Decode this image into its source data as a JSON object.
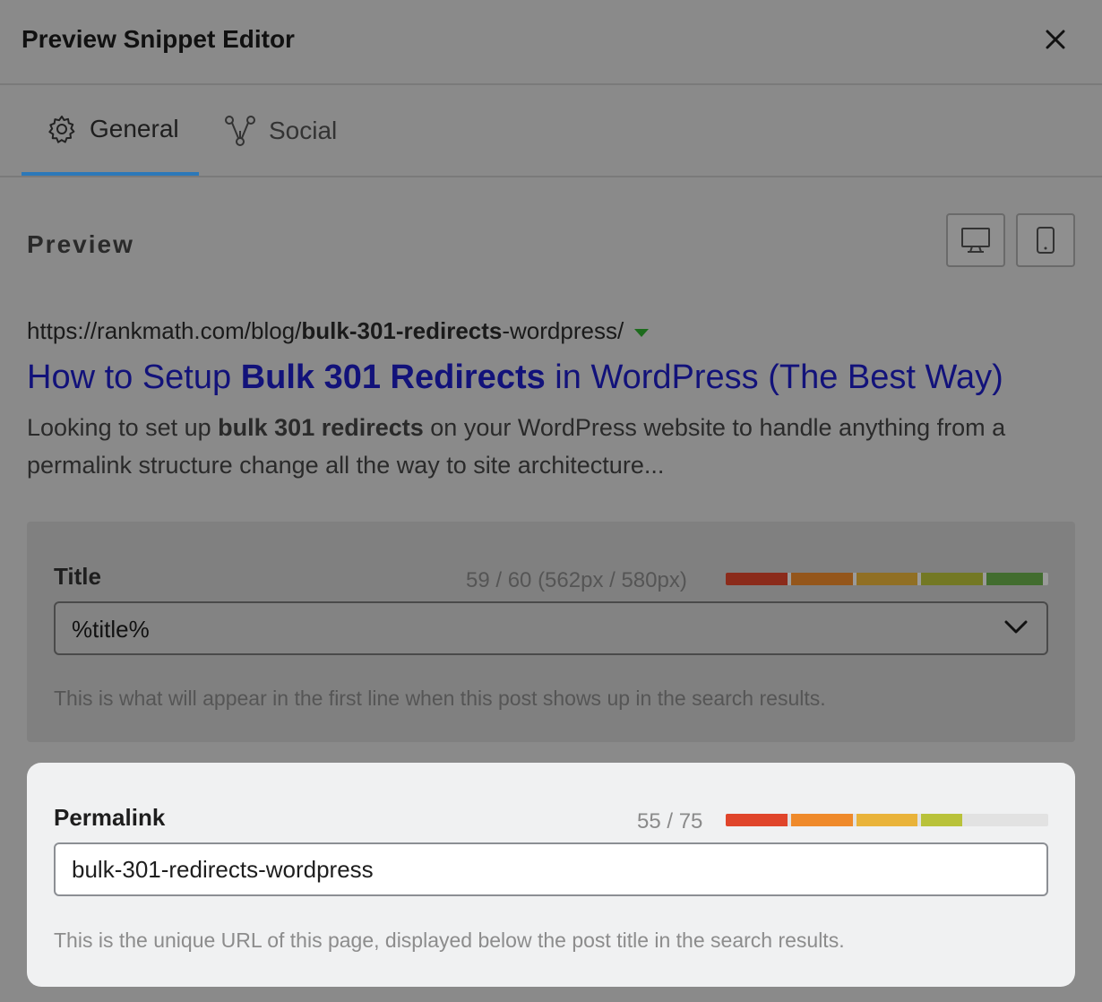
{
  "header": {
    "title": "Preview Snippet Editor"
  },
  "tabs": [
    {
      "label": "General",
      "icon": "gear-icon",
      "active": true
    },
    {
      "label": "Social",
      "icon": "share-nodes-icon",
      "active": false
    }
  ],
  "preview": {
    "label": "Preview",
    "devices": [
      "desktop-icon",
      "mobile-icon"
    ],
    "url": {
      "before": "https://rankmath.com/blog/",
      "bold": "bulk-301-redirects",
      "after": "-wordpress/"
    },
    "title": {
      "before": "How to Setup ",
      "bold": "Bulk 301 Redirects",
      "after": " in WordPress (The Best Way)"
    },
    "description": {
      "before": "Looking to set up ",
      "bold": "bulk 301 redirects",
      "after": " on your WordPress website to handle anything from a permalink structure change all the way to site architecture..."
    }
  },
  "title_field": {
    "label": "Title",
    "counter": "59 / 60 (562px / 580px)",
    "value": "%title%",
    "help": "This is what will appear in the first line when this post shows up in the search results.",
    "meter_fraction": 0.983
  },
  "permalink_field": {
    "label": "Permalink",
    "counter": "55 / 75",
    "value": "bulk-301-redirects-wordpress",
    "help": "This is the unique URL of this page, displayed below the post title in the search results.",
    "meter_fraction": 0.733
  },
  "colors": {
    "accent": "#2c78b8",
    "serp_title": "#12127a",
    "meter": [
      "#e0452b",
      "#ef8a2b",
      "#e9b33a",
      "#b9c23a",
      "#6ab04c"
    ]
  }
}
